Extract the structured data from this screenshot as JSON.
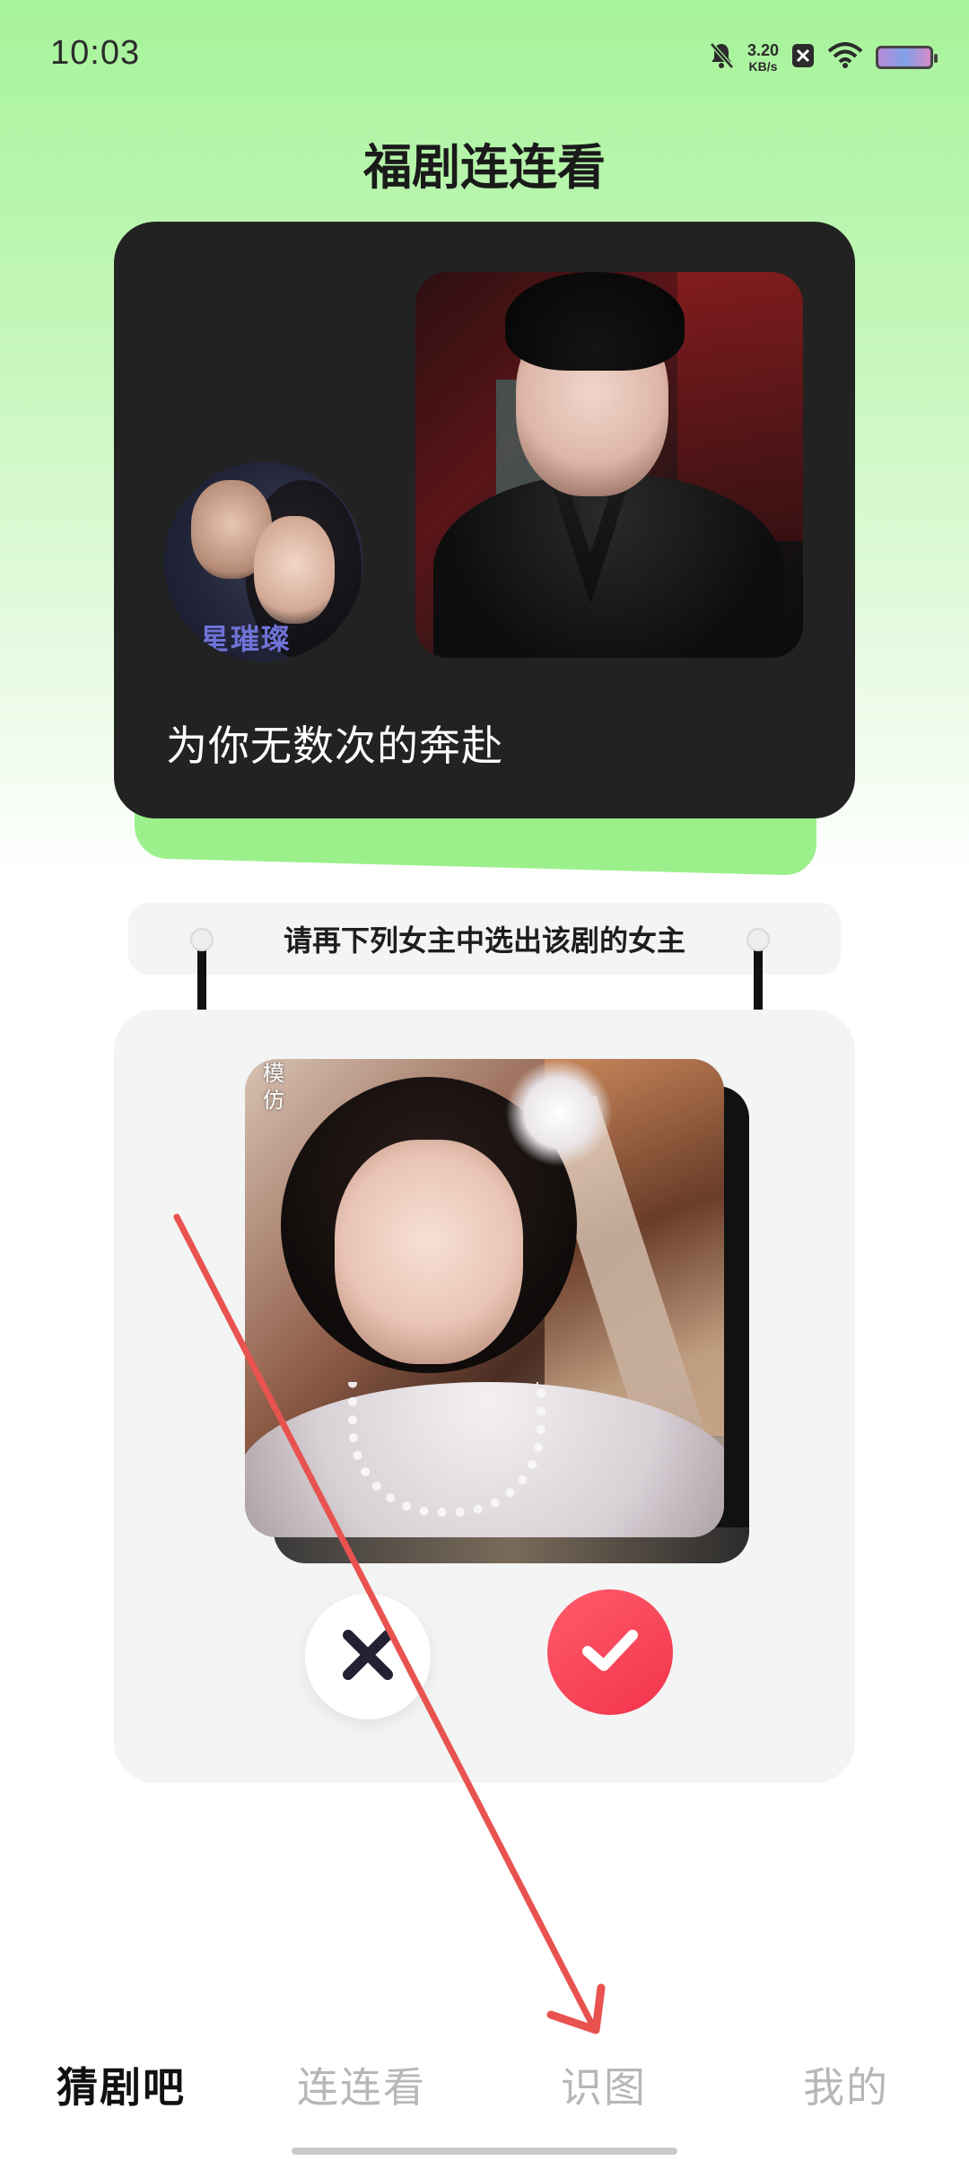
{
  "status_bar": {
    "time": "10:03",
    "net_speed": "3.20",
    "net_unit": "KB/s",
    "icons": [
      "bell-muted-icon",
      "x-app-icon",
      "wifi-icon",
      "battery-icon"
    ]
  },
  "header": {
    "title": "福剧连连看"
  },
  "drama_card": {
    "caption": "为你无数次的奔赴",
    "poster_circle_text": "星璀璨"
  },
  "selection": {
    "instruction": "请再下列女主中选出该剧的女主",
    "candidate_watermark": "模仿"
  },
  "actions": {
    "reject_icon": "close-icon",
    "accept_icon": "check-icon",
    "reject_color": "#222222",
    "accept_color": "#f2334b"
  },
  "tabs": [
    {
      "label": "猜剧吧",
      "active": true
    },
    {
      "label": "连连看",
      "active": false
    },
    {
      "label": "识图",
      "active": false
    },
    {
      "label": "我的",
      "active": false
    }
  ],
  "colors": {
    "accent_green": "#a6f39a",
    "card_dark": "#222222",
    "panel_gray": "#f3f4f4",
    "annotation_arrow": "#e8534f"
  }
}
